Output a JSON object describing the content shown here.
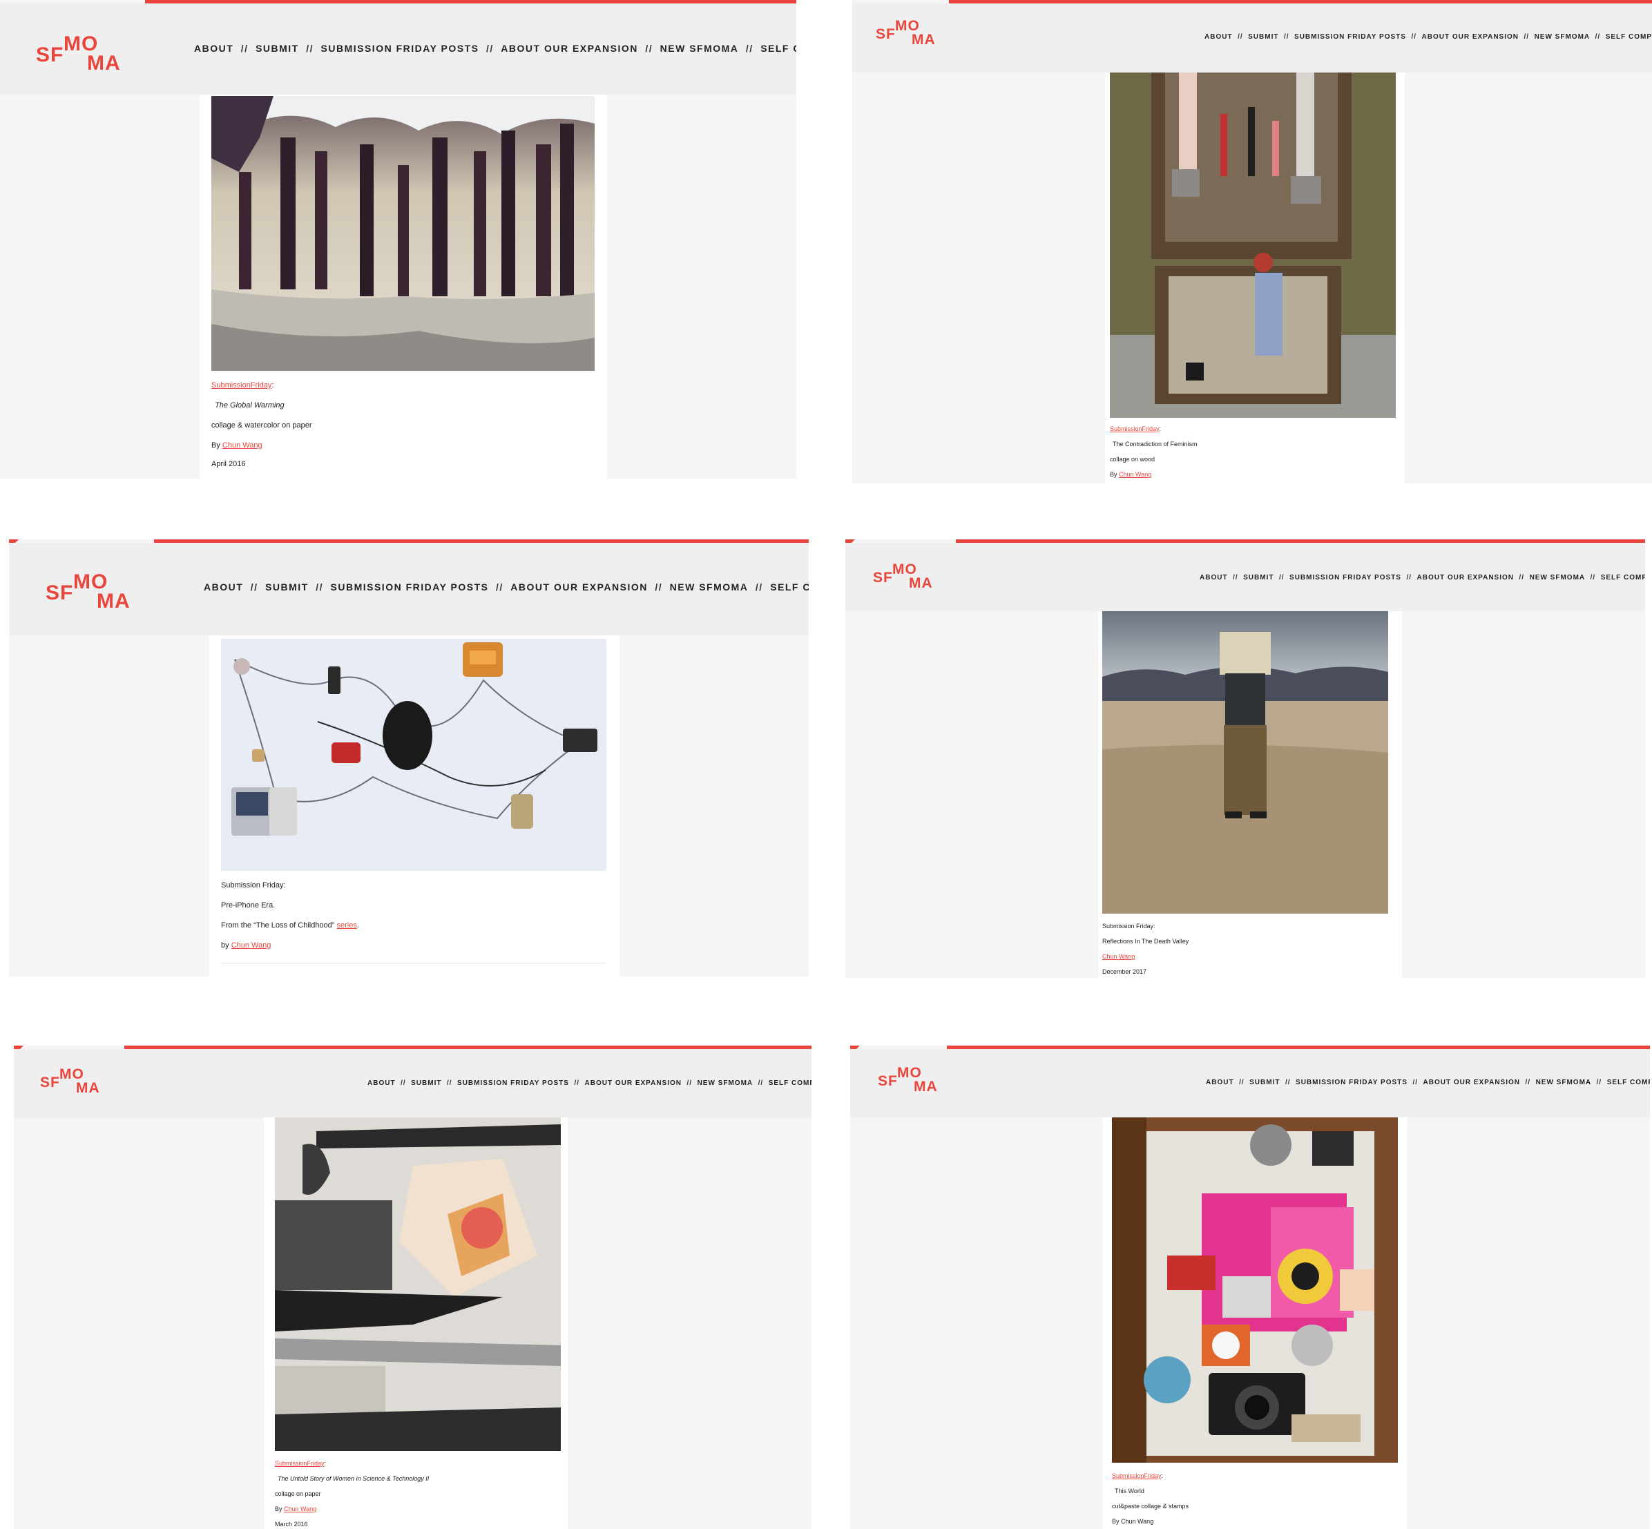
{
  "brand": {
    "logo_sf": "SF",
    "logo_mo": "MO",
    "logo_ma": "MA",
    "accent": "#e8463c",
    "header_bg": "#efefef",
    "page_bg": "#f5f5f5"
  },
  "nav": {
    "about": "ABOUT",
    "submit": "SUBMIT",
    "submission_friday_posts": "SUBMISSION FRIDAY POSTS",
    "about_expansion": "ABOUT OUR EXPANSION",
    "new_sfmoma": "NEW SFMOMA",
    "self_composed": "SELF COMPOSED",
    "separator": "//"
  },
  "posts": [
    {
      "tag": "SubmissionFriday",
      "colon": ":",
      "title": "The Global Warming",
      "medium": "collage & watercolor on paper",
      "by": "By ",
      "artist": "Chun Wang",
      "date": "April 2016"
    },
    {
      "tag": "SubmissionFriday",
      "colon": ":",
      "title": "The Contradiction of Feminism",
      "medium": "collage on wood",
      "by": "By ",
      "artist": "Chun Wang"
    },
    {
      "tag": "Submission Friday:",
      "title": "Pre-iPhone Era.",
      "series_prefix": "From the “The Loss of Childhood” ",
      "series_link": "series",
      "series_suffix": ".",
      "by": "by ",
      "artist": "Chun Wang"
    },
    {
      "tag": "Submission Friday:",
      "title": "Reflections In The Death Valley",
      "artist": "Chun Wang",
      "date": "December 2017"
    },
    {
      "tag": "SubmissionFriday",
      "colon": ":",
      "title": "The Untold Story of Women in Science & Technology II",
      "medium": "collage on paper",
      "by": "By ",
      "artist": "Chun Wang",
      "date": "March 2016"
    },
    {
      "tag": "SubmissionFriday",
      "colon": ":",
      "title": "This World",
      "medium": "cut&paste collage & stamps",
      "byline": "By Chun Wang"
    }
  ],
  "icons": {
    "logo": "sfmoma-logo",
    "nav_separator": "double-slash"
  }
}
